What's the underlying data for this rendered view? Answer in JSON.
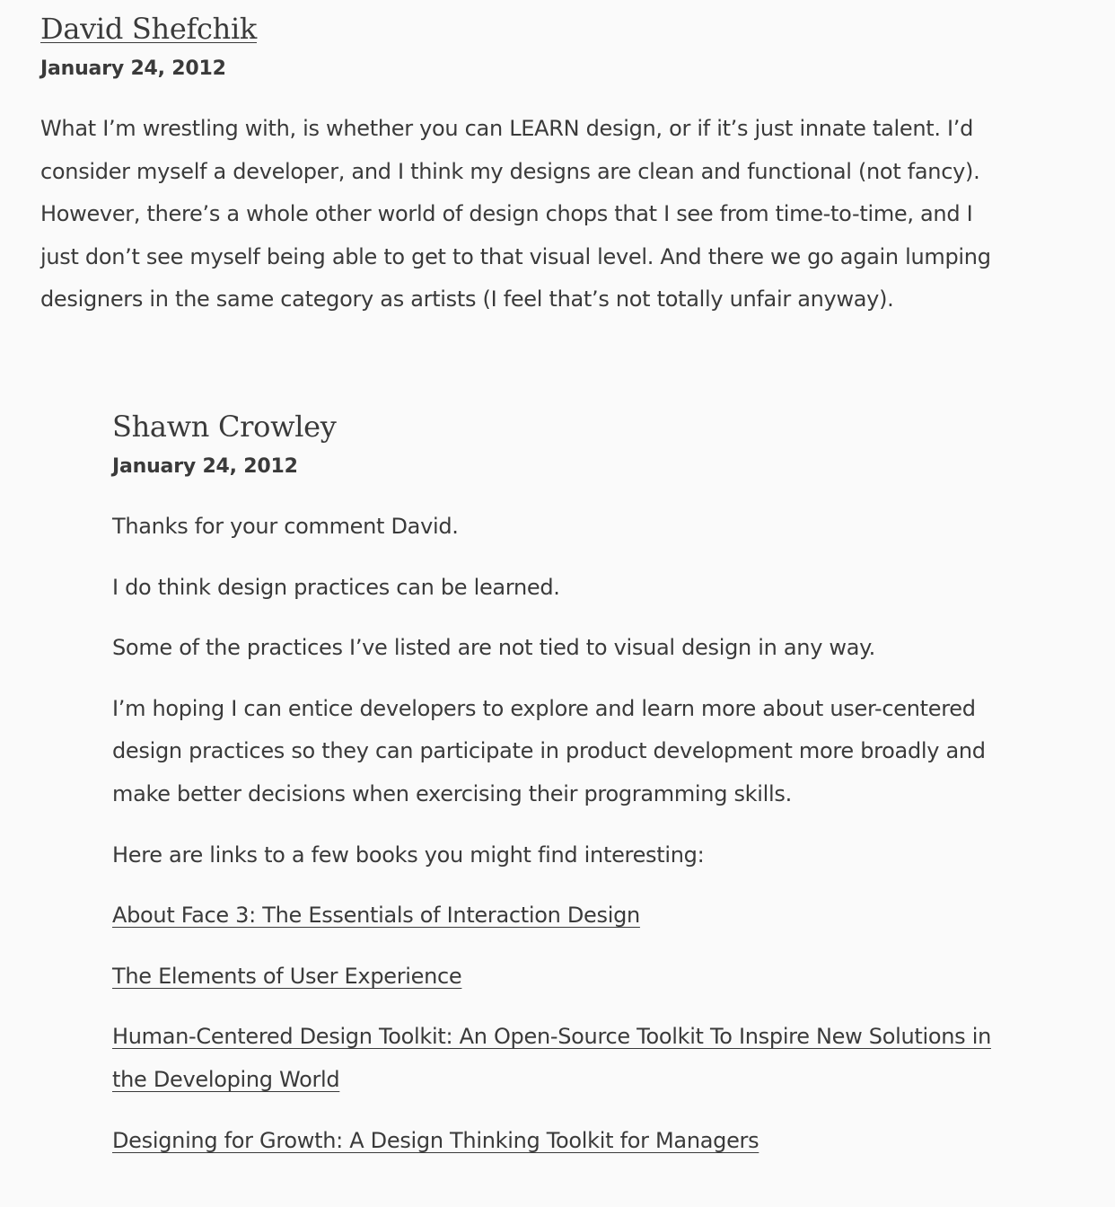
{
  "comment": {
    "author": "David Shefchik",
    "date": "January 24, 2012",
    "text": "What I’m wrestling with, is whether you can LEARN design, or if it’s just innate talent. I’d consider myself a developer, and I think my designs are clean and functional (not fancy). However, there’s a whole other world of design chops that I see from time-to-time, and I just don’t see myself being able to get to that visual level. And there we go again lumping designers in the same category as artists (I feel that’s not totally unfair anyway)."
  },
  "reply": {
    "author": "Shawn Crowley",
    "date": "January 24, 2012",
    "paragraphs": [
      "Thanks for your comment David.",
      "I do think design practices can be learned.",
      "Some of the practices I’ve listed are not tied to visual design in any way.",
      "I’m hoping I can entice developers to explore and learn more about user-centered design practices so they can participate in product development more broadly and make better decisions when exercising their programming skills.",
      "Here are links to a few books you might find interesting:"
    ],
    "links": [
      "About Face 3: The Essentials of Interaction Design",
      "The Elements of User Experience",
      "Human-Centered Design Toolkit: An Open-Source Toolkit To Inspire New Solutions in the Developing World",
      "Designing for Growth: A Design Thinking Toolkit for Managers"
    ]
  }
}
